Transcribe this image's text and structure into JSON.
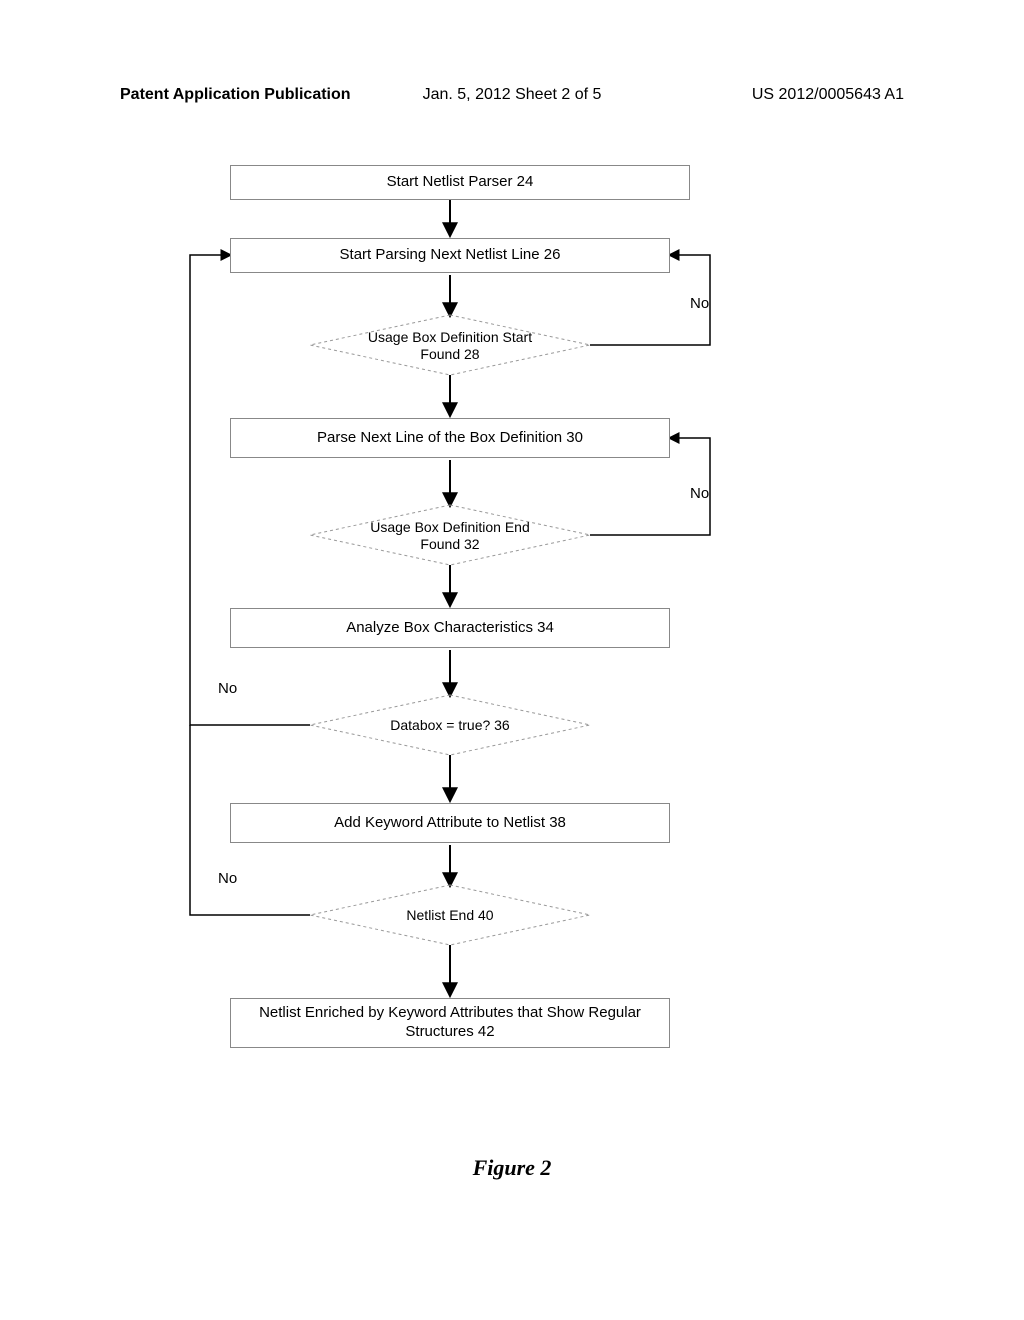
{
  "header": {
    "left": "Patent Application Publication",
    "center": "Jan. 5, 2012   Sheet 2 of 5",
    "right": "US 2012/0005643 A1"
  },
  "figure_label": "Figure 2",
  "flow": {
    "start": "Start Netlist Parser 24",
    "parse_line": "Start Parsing Next Netlist Line 26",
    "usage_start": "Usage Box Definition\nStart Found 28",
    "parse_box_line": "Parse Next Line of the Box Definition 30",
    "usage_end": "Usage Box Definition\nEnd Found 32",
    "analyze": "Analyze Box Characteristics 34",
    "databox": "Databox = true? 36",
    "add_keyword": "Add Keyword Attribute to Netlist 38",
    "netlist_end": "Netlist End 40",
    "enriched": "Netlist Enriched by Keyword Attributes that Show Regular Structures 42"
  },
  "labels": {
    "no": "No"
  }
}
